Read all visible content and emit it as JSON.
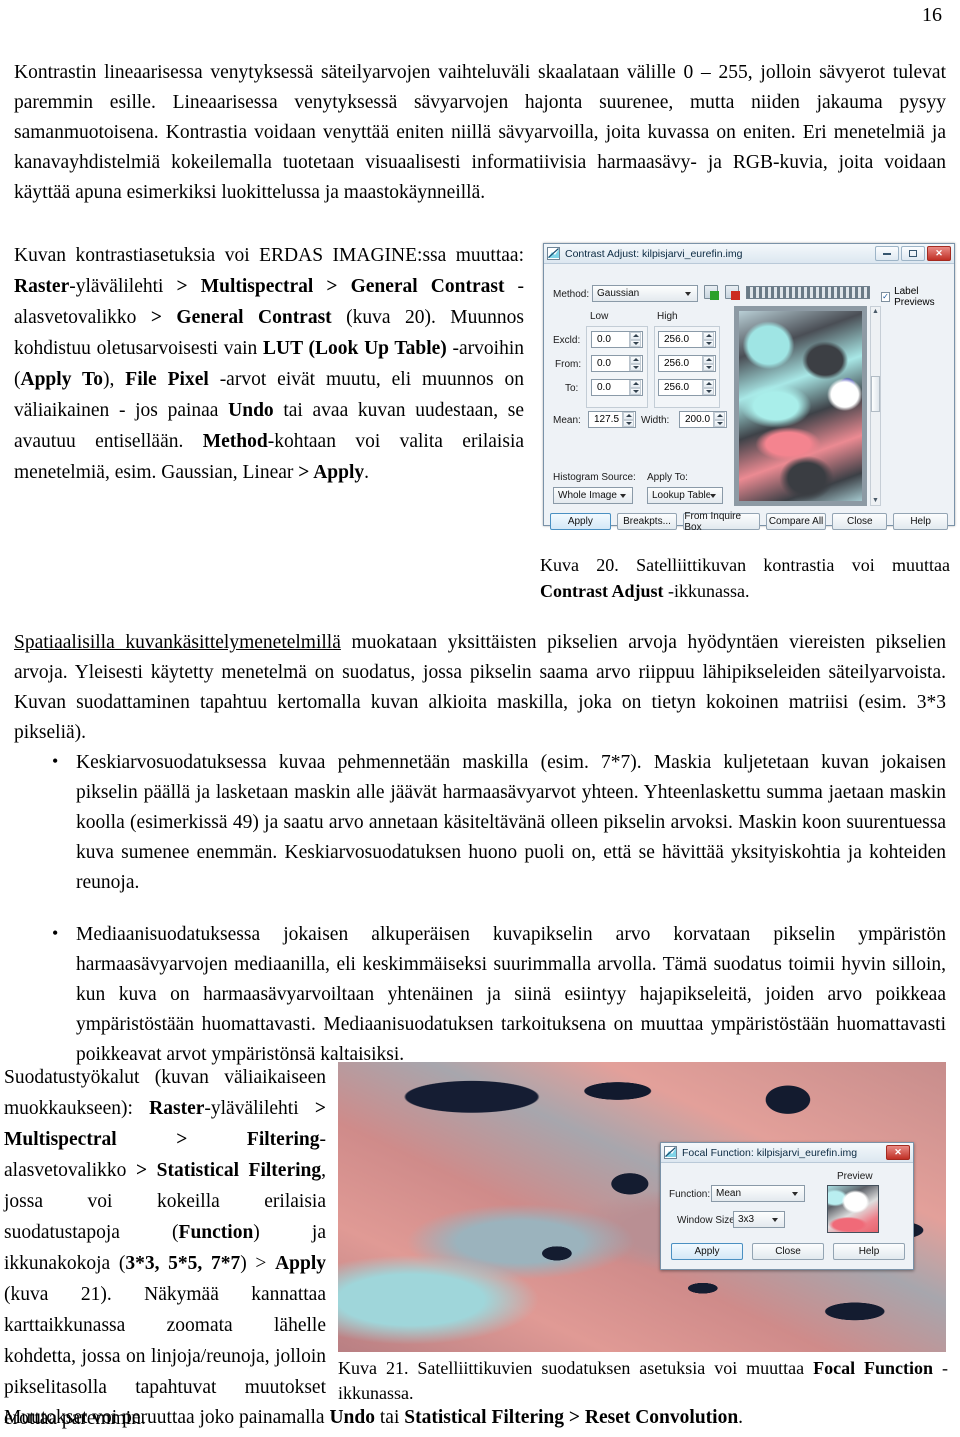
{
  "page": {
    "number": "16"
  },
  "paragraphs": {
    "intro": "Kontrastin lineaarisessa venytyksessä säteilyarvojen vaihteluväli skaalataan välille 0 – 255, jolloin sävyerot tulevat paremmin esille. Lineaarisessa venytyksessä sävyarvojen hajonta suurenee, mutta niiden jakauma pysyy samanmuotoisena. Kontrastia voidaan venyttää eniten niillä sävyarvoilla, joita kuvassa on eniten. Eri menetelmiä ja kanavayhdistelmiä kokeilemalla tuotetaan visuaalisesti informatiivisia harmaasävy- ja RGB-kuvia, joita voidaan käyttää apuna esimerkiksi luokittelussa ja maastokäynneillä.",
    "spatial_lead": "Spatiaalisilla kuvankäsittelymenetelmillä",
    "spatial_rest": " muokataan yksittäisten pikselien arvoja hyödyntäen viereisten pikselien arvoja. Yleisesti käytetty menetelmä on suodatus, jossa pikselin saama arvo riippuu lähipikseleiden säteilyarvoista. Kuvan suodattaminen tapahtuu kertomalla kuvan alkioita maskilla, joka on tietyn kokoinen matriisi (esim. 3*3 pikseliä).",
    "bullet1": "Keskiarvosuodatuksessa kuvaa pehmennetään maskilla (esim. 7*7). Maskia kuljetetaan kuvan jokaisen pikselin päällä ja lasketaan maskin alle jäävät harmaasävyarvot yhteen. Yhteenlaskettu summa jaetaan maskin koolla (esimerkissä 49) ja saatu arvo annetaan käsiteltävänä olleen pikselin arvoksi. Maskin koon suurentuessa kuva sumenee enemmän. Keskiarvosuodatuksen huono puoli on, että se hävittää yksityiskohtia ja kohteiden reunoja.",
    "bullet2": "Mediaanisuodatuksessa jokaisen alkuperäisen kuvapikselin arvo korvataan pikselin ympäristön harmaasävyarvojen mediaanilla, eli keskimmäiseksi suurimmalla arvolla. Tämä suodatus toimii hyvin silloin, kun kuva on harmaasävyarvoiltaan yhtenäinen ja siinä esiintyy hajapikseleitä, joiden arvo poikkeaa ympäristöstään huomattavasti. Mediaanisuodatuksen tarkoituksena on muuttaa ympäristöstään huomattavasti poikkeavat arvot ympäristönsä kaltaisiksi."
  },
  "col_left": {
    "t1": "Kuvan kontrastiasetuksia voi ERDAS IMAGINE:ssa muuttaa: ",
    "b1": "Raster",
    "t2": "-ylävälilehti ",
    "b2": "> Multispectral > General Contrast",
    "t3": " -alasvetovalikko ",
    "b3": "> General Contrast",
    "t4": " (kuva 20). Muunnos kohdistuu oletusarvoisesti vain ",
    "b4": "LUT (Look Up Table)",
    "t5": " -arvoihin (",
    "b5": "Apply To",
    "t6": "), ",
    "b6": "File Pixel",
    "t7": " -arvot eivät muutu, eli muunnos on väliaikainen - jos painaa ",
    "b7": "Undo",
    "t8": " tai avaa kuvan uudestaan, se avautuu entisellään. ",
    "b8": "Method",
    "t9": "-kohtaan voi valita erilaisia menetelmiä, esim. Gaussian, Linear ",
    "b9": "> Apply",
    "t10": "."
  },
  "col_left_bottom": {
    "t1": "Suodatustyökalut (kuvan väliaikaiseen muokkaukseen): ",
    "b1": "Raster",
    "t2": "-ylävälilehti ",
    "b2": "> Multispectral > Filtering",
    "t3": "-alasvetovalikko ",
    "b3": "> Statistical Filtering",
    "t4": ", jossa voi kokeilla erilaisia suodatustapoja (",
    "b4": "Function",
    "t5": ") ja ikkunakokoja (",
    "b5": "3*3, 5*5, 7*7",
    "t6": ") > ",
    "b6": "Apply",
    "t7": " (kuva 21). Näkymää kannattaa karttaikkunassa zoomata lähelle kohdetta, jossa on linjoja/reunoja, jolloin pikselitasolla tapahtuvat muutokset erottaa paremmin."
  },
  "last_line": {
    "t1": "Muutokset voi peruuttaa joko painamalla ",
    "b1": "Undo",
    "t2": " tai ",
    "b2": "Statistical Filtering > Reset Convolution",
    "t3": "."
  },
  "captions": {
    "kuva20_t1": "Kuva 20. Satelliittikuvan kontrastia voi muuttaa ",
    "kuva20_b": "Contrast Adjust",
    "kuva20_t2": " -ikkunassa.",
    "kuva21_t1": "Kuva 21. Satelliittikuvien suodatuksen asetuksia voi muuttaa ",
    "kuva21_b": "Focal Function",
    "kuva21_t2": " -ikkunassa."
  },
  "contrast_dialog": {
    "title": "Contrast Adjust: kilpisjarvi_eurefin.img",
    "minimize": "—",
    "maximize": "▫",
    "close": "✕",
    "method_label": "Method:",
    "method_value": "Gaussian",
    "label_previews": "Label Previews",
    "label_previews_checked": "✓",
    "col_low": "Low",
    "col_high": "High",
    "rows": [
      {
        "label": "Excld:",
        "low": "0.0",
        "high": "256.0"
      },
      {
        "label": "From:",
        "low": "0.0",
        "high": "256.0"
      },
      {
        "label": "To:",
        "low": "0.0",
        "high": "256.0"
      }
    ],
    "mean_label": "Mean:",
    "mean_value": "127.5",
    "width_label": "Width:",
    "width_value": "200.0",
    "hist_source_label": "Histogram Source:",
    "hist_source_value": "Whole Image",
    "apply_to_label": "Apply To:",
    "apply_to_value": "Lookup Table",
    "buttons": [
      "Apply",
      "Breakpts...",
      "From Inquire Box",
      "Compare All",
      "Close",
      "Help"
    ]
  },
  "focal_dialog": {
    "title": "Focal Function: kilpisjarvi_eurefin.img",
    "close": "✕",
    "function_label": "Function:",
    "function_value": "Mean",
    "window_label": "Window Size:",
    "window_value": "3x3",
    "preview_label": "Preview",
    "buttons": [
      "Apply",
      "Close",
      "Help"
    ]
  },
  "colors": {
    "titlebar": "#dce7f0",
    "close_red": "#c02f25",
    "accent_blue": "#4a90c2"
  }
}
